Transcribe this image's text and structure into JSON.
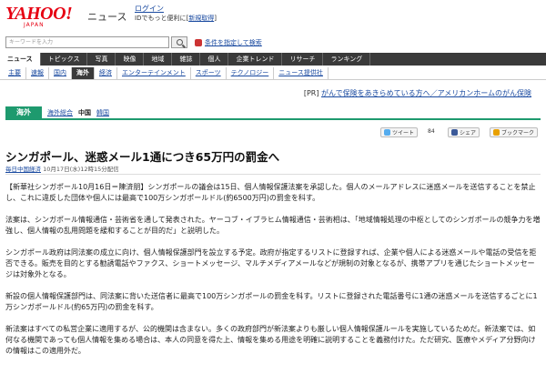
{
  "header": {
    "logo": "YAHOO!",
    "logo_sub": "JAPAN",
    "section": "ニュース",
    "login": "ログイン",
    "login_sub_prefix": "IDでもっと便利に",
    "register_open": "[",
    "register": "新規取得",
    "register_close": "]"
  },
  "search": {
    "placeholder": "キーワードを入力",
    "advanced": "条件を指定して検索"
  },
  "category_nav": [
    "ニュース",
    "トピックス",
    "写真",
    "映像",
    "地域",
    "雑誌",
    "個人",
    "企業トレンド",
    "リサーチ",
    "ランキング"
  ],
  "sub_nav": [
    "主要",
    "速報",
    "国内",
    "海外",
    "経済",
    "エンターテインメント",
    "スポーツ",
    "テクノロジー",
    "ニュース提供社"
  ],
  "pr": {
    "prefix": "[PR]",
    "text": "がんで保険をあきらめている方へ／アメリカンホームのがん保険"
  },
  "region": {
    "tab": "海外",
    "links": [
      "海外総合",
      "中国",
      "韓国"
    ]
  },
  "social": {
    "tweet": "ツイート",
    "tweet_count": "84",
    "share": "シェア",
    "bookmark": "ブックマーク"
  },
  "article": {
    "title": "シンガポール、迷惑メール1通につき65万円の罰金へ",
    "source": "毎日中国経済",
    "date": "10月17日(水)12時15分配信",
    "paragraphs": [
      "【新華社シンガポール10月16日＝陳済朋】シンガポールの議会は15日、個人情報保護法案を承認した。個人のメールアドレスに迷惑メールを送信することを禁止し、これに違反した団体や個人には最高で100万シンガポールドル(約6500万円)の罰金を科す。",
      "法案は、シンガポール情報通信・芸術省を通して発表された。ヤーコブ・イブラヒム情報通信・芸術相は、「地域情報処理の中枢としてのシンガポールの競争力を増強し、個人情報の乱用問題を緩和することが目的だ」と説明した。",
      "シンガポール政府は同法案の成立に向け、個人情報保護部門を設立する予定。政府が指定するリストに登録すれば、企業や個人による迷惑メールや電話の受信を拒否できる。販売を目的とする勧誘電話やファクス、ショートメッセージ、マルチメディアメールなどが規制の対象となるが、携帯アプリを通じたショートメッセージは対象外となる。",
      "新設の個人情報保護部門は、同法案に背いた送信者に最高で100万シンガポールの罰金を科す。リストに登録された電話番号に1通の迷惑メールを送信するごとに1万シンガポールドル(約65万円)の罰金を科す。",
      "新法案はすべての私営企業に適用するが、公的機関は含まない。多くの政府部門が新法案よりも厳しい個人情報保護ルールを実施しているためだ。新法案では、如何なる機関であっても個人情報を集める場合は、本人の同意を得た上、情報を集める用途を明確に説明することを義務付けた。ただ研究、医療やメディア分野向けの情報はこの適用外だ。"
    ]
  },
  "colors": {
    "brand": "#e60012",
    "link": "#1a4aa0",
    "nav_dark": "#3a3a3a",
    "region_green": "#1e9a6e"
  }
}
